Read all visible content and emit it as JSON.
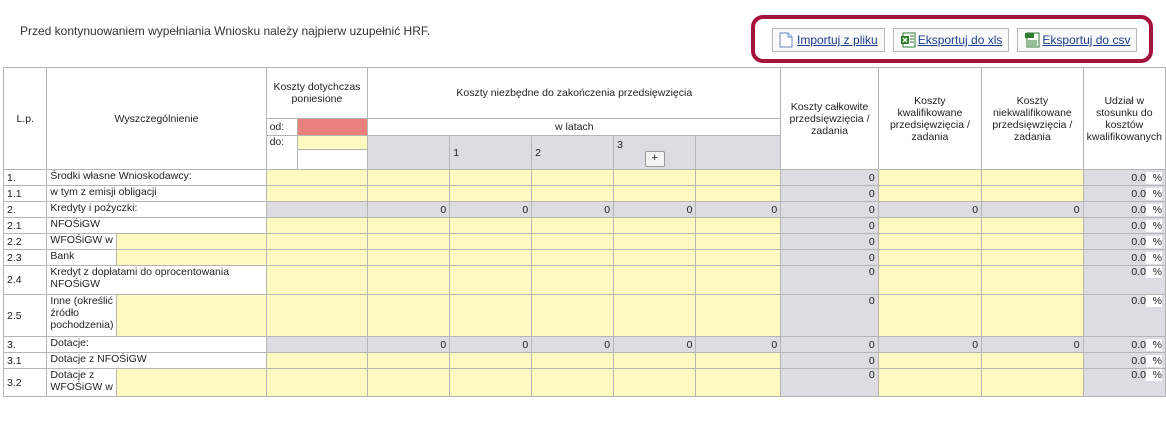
{
  "notice": "Przed kontynuowaniem wypełniania Wniosku należy najpierw uzupełnić HRF.",
  "toolbar": {
    "import_label": "Importuj z pliku",
    "export_xls_label": "Eksportuj do xls",
    "export_csv_label": "Eksportuj do csv"
  },
  "header": {
    "lp": "L.p.",
    "wyszczegolnienie": "Wyszczególnienie",
    "koszty_dotychczas": "Koszty dotychczas poniesione",
    "koszty_niezbedne": "Koszty niezbędne do zakończenia przedsięwzięcia",
    "od": "od:",
    "do": "do:",
    "w_latach": "w latach",
    "year1": "1",
    "year2": "2",
    "year3": "3",
    "plus": "+",
    "koszty_calkowite": "Koszty całkowite przedsięwzięcia / zadania",
    "koszty_kwalifikowane": "Koszty kwalifikowane przedsięwzięcia / zadania",
    "koszty_niekwalifikowane": "Koszty niekwalifikowane przedsięwzięcia / zadania",
    "udzial": "Udział w stosunku do kosztów kwalifikowanych"
  },
  "rows": [
    {
      "lp": "1.",
      "name": "Środki własne Wnioskodawcy:",
      "sub": false,
      "type": "input",
      "total": "0",
      "pct": "0.0",
      "pct_sign": "%"
    },
    {
      "lp": "1.1",
      "name": "w tym z emisji obligacji",
      "sub": false,
      "type": "input",
      "total": "0",
      "pct": "0.0",
      "pct_sign": "%"
    },
    {
      "lp": "2.",
      "name": "Kredyty i pożyczki:",
      "sub": false,
      "type": "sum",
      "vals": [
        "0",
        "0",
        "0",
        "0",
        "0"
      ],
      "total": "0",
      "kw": "0",
      "nkw": "0",
      "pct": "0.0",
      "pct_sign": "%"
    },
    {
      "lp": "2.1",
      "name": "NFOŚiGW",
      "sub": false,
      "type": "input",
      "total": "0",
      "pct": "0.0",
      "pct_sign": "%"
    },
    {
      "lp": "2.2",
      "name": "WFOŚiGW w",
      "sub": true,
      "type": "input",
      "total": "0",
      "pct": "0.0",
      "pct_sign": "%"
    },
    {
      "lp": "2.3",
      "name": "Bank",
      "sub": true,
      "type": "input",
      "total": "0",
      "pct": "0.0",
      "pct_sign": "%"
    },
    {
      "lp": "2.4",
      "name": "Kredyt z dopłatami do oprocentowania NFOŚiGW",
      "sub": false,
      "type": "input",
      "total": "0",
      "pct": "0.0",
      "pct_sign": "%"
    },
    {
      "lp": "2.5",
      "name": "Inne (określić źródło pochodzenia)",
      "sub": true,
      "type": "input",
      "total": "0",
      "pct": "0.0",
      "pct_sign": "%"
    },
    {
      "lp": "3.",
      "name": "Dotacje:",
      "sub": false,
      "type": "sum",
      "vals": [
        "0",
        "0",
        "0",
        "0",
        "0"
      ],
      "total": "0",
      "kw": "0",
      "nkw": "0",
      "pct": "0.0",
      "pct_sign": "%"
    },
    {
      "lp": "3.1",
      "name": "Dotacje z NFOŚiGW",
      "sub": false,
      "type": "input",
      "total": "0",
      "pct": "0.0",
      "pct_sign": "%"
    },
    {
      "lp": "3.2",
      "name": "Dotacje z WFOŚiGW w",
      "sub": true,
      "type": "input",
      "total": "0",
      "pct": "0.0",
      "pct_sign": "%"
    }
  ]
}
